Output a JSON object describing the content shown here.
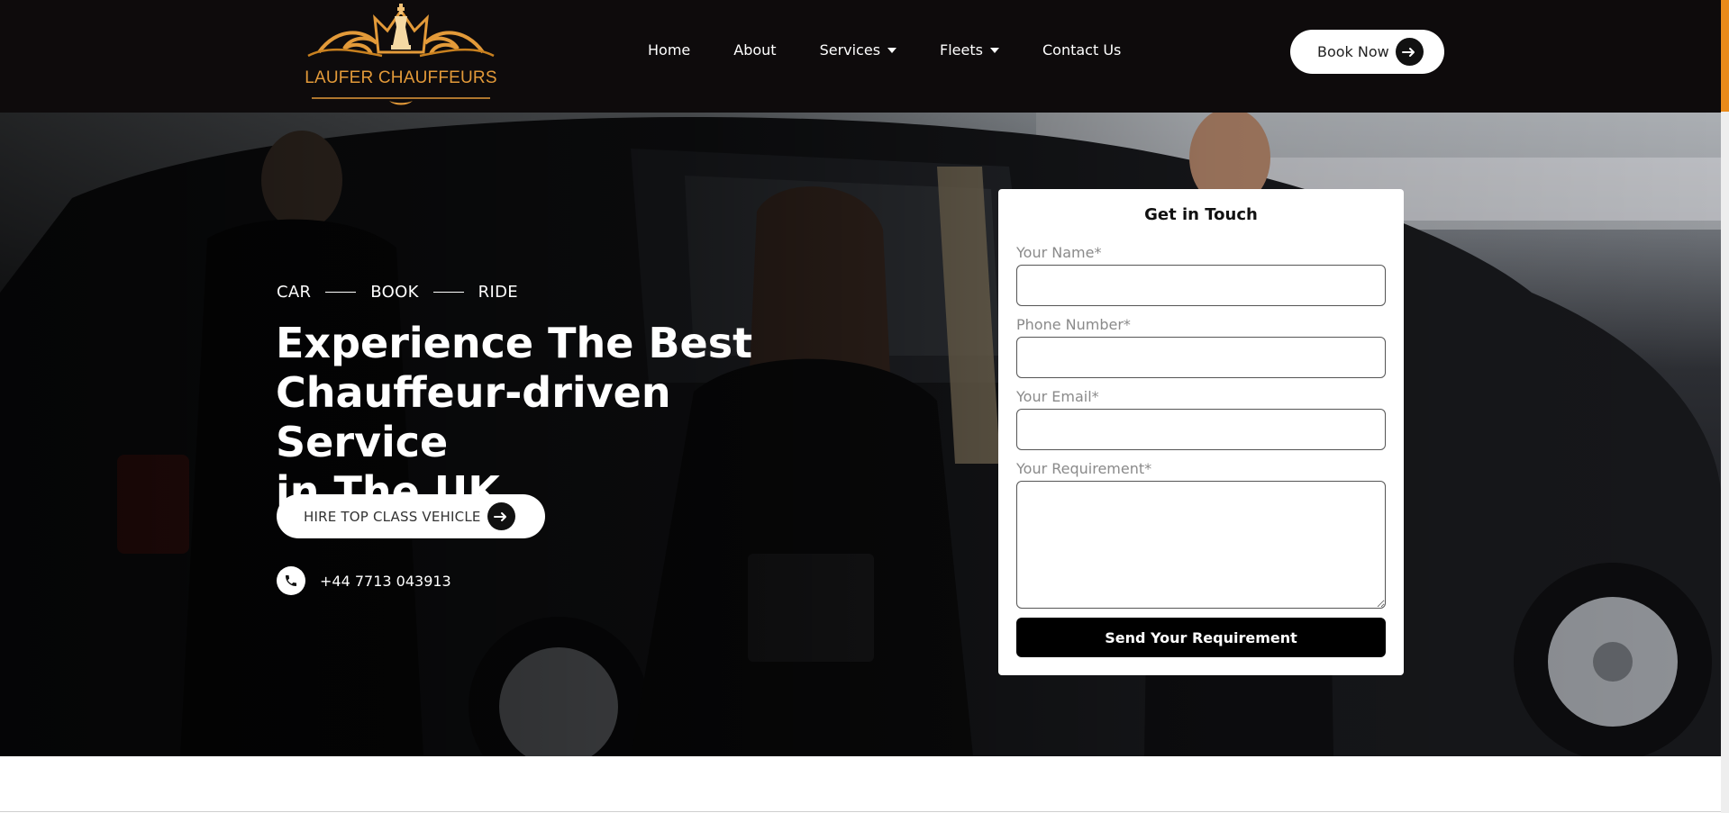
{
  "brand": {
    "name": "LAUFER CHAUFFEURS",
    "accent": "#e39a39"
  },
  "nav": {
    "items": [
      {
        "label": "Home",
        "dropdown": false
      },
      {
        "label": "About",
        "dropdown": false
      },
      {
        "label": "Services",
        "dropdown": true
      },
      {
        "label": "Fleets",
        "dropdown": true
      },
      {
        "label": "Contact Us",
        "dropdown": false
      }
    ],
    "book_label": "Book Now"
  },
  "hero": {
    "tagline": [
      "CAR",
      "BOOK",
      "RIDE"
    ],
    "headline_lines": [
      "Experience The Best",
      "Chauffeur-driven Service",
      "in The UK"
    ],
    "cta_label": "HIRE TOP CLASS VEHICLE",
    "phone": "+44 7713 043913"
  },
  "form": {
    "title": "Get in Touch",
    "fields": [
      {
        "label": "Your Name*",
        "value": ""
      },
      {
        "label": "Phone Number*",
        "value": ""
      },
      {
        "label": "Your Email*",
        "value": ""
      },
      {
        "label": "Your Requirement*",
        "value": ""
      }
    ],
    "submit_label": "Send Your Requirement"
  },
  "icons": {
    "logo": "crown-chess-king-logo",
    "arrow": "arrow-right-icon",
    "phone": "phone-icon",
    "caret": "caret-down-icon"
  },
  "colors": {
    "header_bg": "#0e0b0c",
    "scroll_thumb": "#e98a1a",
    "button_dark": "#000000"
  }
}
